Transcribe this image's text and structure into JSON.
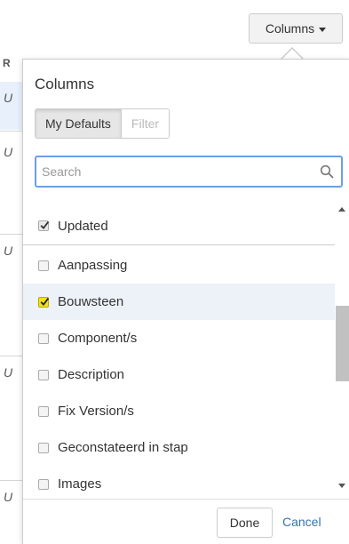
{
  "background": {
    "header_cell": "R",
    "row_cells": [
      "U",
      "U",
      "U",
      "U",
      "U"
    ]
  },
  "toolbar": {
    "columns_label": "Columns",
    "caret_icon": "chevron-down-icon"
  },
  "popup": {
    "title": "Columns",
    "tabs": [
      {
        "label": "My Defaults",
        "active": true
      },
      {
        "label": "Filter",
        "active": false
      }
    ],
    "search": {
      "placeholder": "Search",
      "value": "",
      "icon": "search-icon"
    },
    "pinned_item": {
      "label": "Updated",
      "checked": true
    },
    "items": [
      {
        "label": "Aanpassing",
        "checked": false,
        "highlighted": false
      },
      {
        "label": "Bouwsteen",
        "checked": true,
        "highlighted": true
      },
      {
        "label": "Component/s",
        "checked": false,
        "highlighted": false
      },
      {
        "label": "Description",
        "checked": false,
        "highlighted": false
      },
      {
        "label": "Fix Version/s",
        "checked": false,
        "highlighted": false
      },
      {
        "label": "Geconstateerd in stap",
        "checked": false,
        "highlighted": false
      },
      {
        "label": "Images",
        "checked": false,
        "highlighted": false
      }
    ],
    "footer": {
      "done_label": "Done",
      "cancel_label": "Cancel"
    }
  },
  "colors": {
    "accent_link": "#3572b0",
    "focus_border": "#6c9ee8",
    "highlight_row": "#edf2f9",
    "checkbox_highlight": "#f3e21b"
  }
}
